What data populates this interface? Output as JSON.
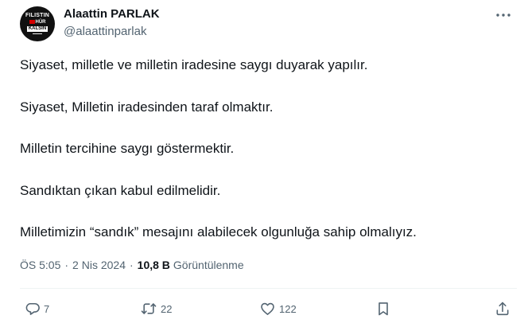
{
  "author": {
    "display_name": "Alaattin PARLAK",
    "handle": "@alaattinparlak",
    "avatar_text": [
      "FILISTIN",
      "HÜR",
      "KALSIN"
    ]
  },
  "menu": {
    "icon": "more-horizontal-icon"
  },
  "tweet": {
    "lines": [
      "Siyaset, milletle ve milletin iradesine saygı duyarak yapılır.",
      "Siyaset, Milletin iradesinden taraf olmaktır.",
      "Milletin tercihine saygı göstermektir.",
      "Sandıktan çıkan kabul edilmelidir.",
      "Milletimizin “sandık” mesajını alabilecek olgunluğa sahip olmalıyız."
    ]
  },
  "meta": {
    "time": "ÖS 5:05",
    "separator": "·",
    "date": "2 Nis 2024",
    "views_count": "10,8 B",
    "views_label": "Görüntülenme"
  },
  "actions": {
    "reply": {
      "icon": "reply-icon",
      "count": "7"
    },
    "retweet": {
      "icon": "retweet-icon",
      "count": "22"
    },
    "like": {
      "icon": "heart-icon",
      "count": "122"
    },
    "bookmark": {
      "icon": "bookmark-icon"
    },
    "share": {
      "icon": "share-icon"
    }
  },
  "colors": {
    "text_primary": "#0f1419",
    "text_secondary": "#536471",
    "divider": "#eff3f4"
  }
}
